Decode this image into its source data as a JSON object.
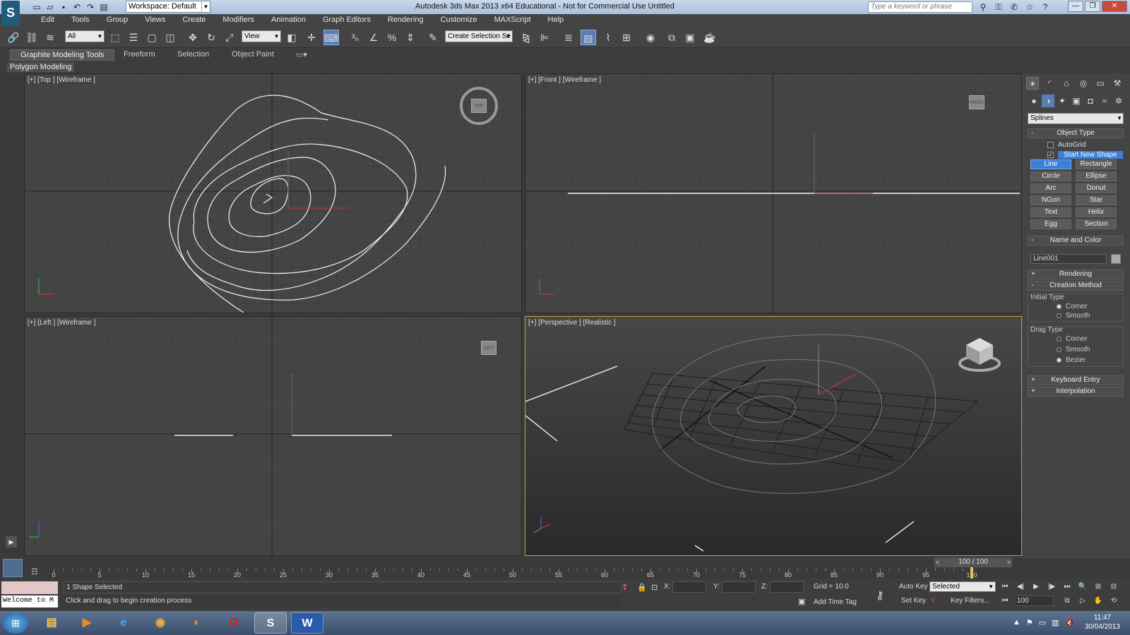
{
  "window": {
    "title": "Autodesk 3ds Max  2013 x64    Educational - Not for Commercial Use    Untitled",
    "logo": "3ds-max-logo",
    "workspace": "Workspace: Default",
    "search_placeholder": "Type a keyword or phrase",
    "minimize": "—",
    "maximize": "❐",
    "close": "✕"
  },
  "menu": [
    "Edit",
    "Tools",
    "Group",
    "Views",
    "Create",
    "Modifiers",
    "Animation",
    "Graph Editors",
    "Rendering",
    "Customize",
    "MAXScript",
    "Help"
  ],
  "toolbar": {
    "selection_filter": "All",
    "reference_coord": "View",
    "named_selection": "Create Selection Se"
  },
  "ribbon": {
    "tabs": [
      "Graphite Modeling Tools",
      "Freeform",
      "Selection",
      "Object Paint"
    ],
    "active_tab": "Graphite Modeling Tools",
    "sub_panel": "Polygon Modeling"
  },
  "viewports": {
    "top": {
      "label": "[+] [Top ] [Wireframe ]",
      "cube": "TOP"
    },
    "front": {
      "label": "[+] [Front ] [Wireframe ]",
      "cube": "FRONT"
    },
    "left": {
      "label": "[+] [Left ] [Wireframe ]",
      "cube": "LEFT"
    },
    "perspective": {
      "label": "[+] [Perspective ] [Realistic ]"
    }
  },
  "command_panel": {
    "category": "Splines",
    "object_type_title": "Object Type",
    "autogrid": "AutoGrid",
    "start_new_shape": "Start New Shape",
    "buttons": [
      [
        "Line",
        "Rectangle"
      ],
      [
        "Circle",
        "Ellipse"
      ],
      [
        "Arc",
        "Donut"
      ],
      [
        "NGon",
        "Star"
      ],
      [
        "Text",
        "Helix"
      ],
      [
        "Egg",
        "Section"
      ]
    ],
    "active_button": "Line",
    "name_and_color": "Name and Color",
    "object_name": "Line001",
    "rendering": "Rendering",
    "creation_method": "Creation Method",
    "initial_type": "Initial Type",
    "initial_options": [
      "Corner",
      "Smooth"
    ],
    "drag_type": "Drag Type",
    "drag_options": [
      "Corner",
      "Smooth",
      "Bezier"
    ],
    "keyboard_entry": "Keyboard Entry",
    "interpolation": "Interpolation"
  },
  "timeline": {
    "frame_display": "100 / 100",
    "ticks": [
      0,
      5,
      10,
      15,
      20,
      25,
      30,
      35,
      40,
      45,
      50,
      55,
      60,
      65,
      70,
      75,
      80,
      85,
      90,
      95,
      100
    ]
  },
  "status": {
    "listener_text": "Welcome to M",
    "selection_text": "1 Shape Selected",
    "prompt_text": "Click and drag to begin creation process",
    "x_label": "X:",
    "y_label": "Y:",
    "z_label": "Z:",
    "grid": "Grid = 10.0",
    "add_time_tag": "Add Time Tag",
    "auto_key": "Auto Key",
    "set_key": "Set Key",
    "key_mode": "Selected",
    "key_filters": "Key Filters...",
    "current_frame": "100"
  },
  "taskbar": {
    "time": "11:47",
    "date": "30/04/2013",
    "apps": [
      "explorer",
      "media-player",
      "internet-explorer",
      "chrome",
      "firefox",
      "opera",
      "3ds-max",
      "word"
    ]
  },
  "colors": {
    "accent_blue": "#3d7fd6",
    "active_viewport_border": "#c2a43b",
    "viewport_bg": "#454545"
  }
}
